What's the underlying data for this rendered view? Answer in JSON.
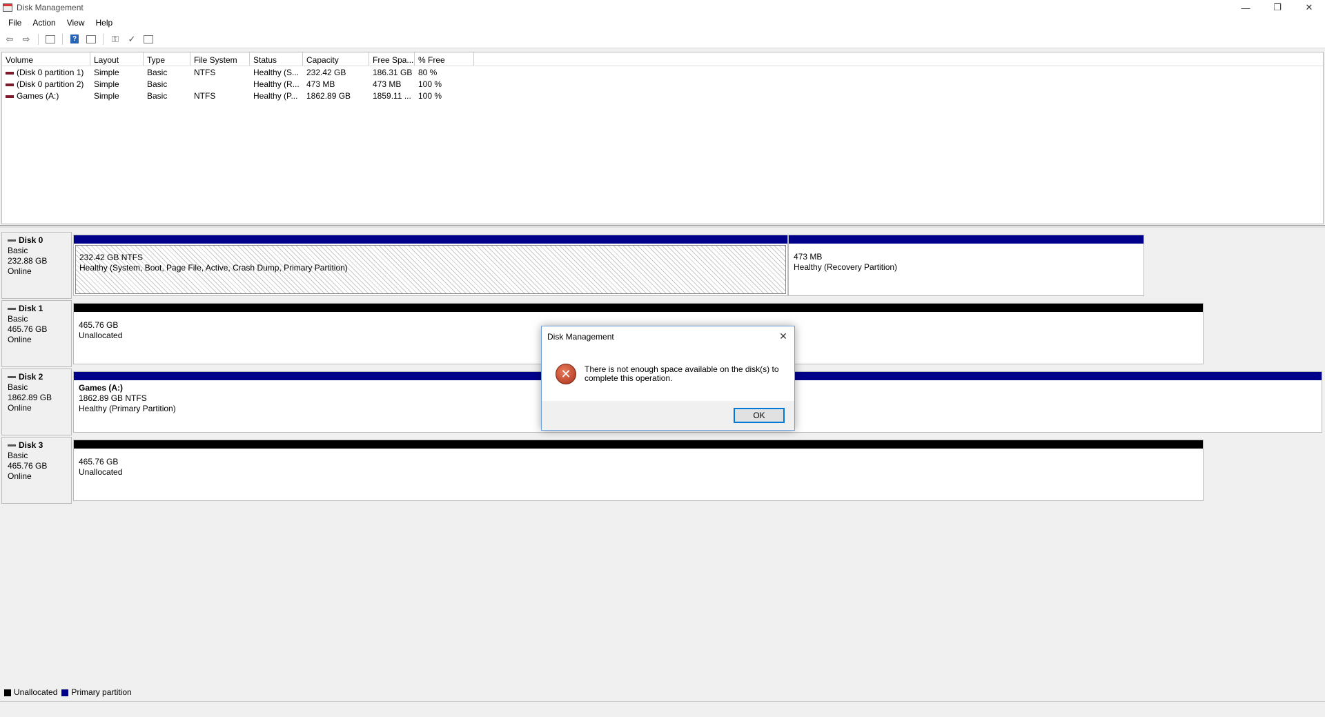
{
  "window": {
    "title": "Disk Management",
    "minimize_glyph": "—",
    "restore_glyph": "❐",
    "close_glyph": "✕"
  },
  "menu": [
    "File",
    "Action",
    "View",
    "Help"
  ],
  "toolbar": {
    "back_glyph": "⇦",
    "forward_glyph": "⇨",
    "help_glyph": "?",
    "check_glyph": "✓",
    "key_glyph": "⚿"
  },
  "volume_table": {
    "headers": [
      "Volume",
      "Layout",
      "Type",
      "File System",
      "Status",
      "Capacity",
      "Free Spa...",
      "% Free"
    ],
    "rows": [
      [
        "(Disk 0 partition 1)",
        "Simple",
        "Basic",
        "NTFS",
        "Healthy (S...",
        "232.42 GB",
        "186.31 GB",
        "80 %"
      ],
      [
        "(Disk 0 partition 2)",
        "Simple",
        "Basic",
        "",
        "Healthy (R...",
        "473 MB",
        "473 MB",
        "100 %"
      ],
      [
        "Games (A:)",
        "Simple",
        "Basic",
        "NTFS",
        "Healthy (P...",
        "1862.89 GB",
        "1859.11 ...",
        "100 %"
      ]
    ]
  },
  "disks": [
    {
      "name": "Disk 0",
      "type": "Basic",
      "size": "232.88 GB",
      "state": "Online",
      "partitions": [
        {
          "title": "",
          "line1": "232.42 GB NTFS",
          "line2": "Healthy (System, Boot, Page File, Active, Crash Dump, Primary Partition)"
        },
        {
          "title": "",
          "line1": "473 MB",
          "line2": "Healthy (Recovery Partition)"
        }
      ]
    },
    {
      "name": "Disk 1",
      "type": "Basic",
      "size": "465.76 GB",
      "state": "Online",
      "partitions": [
        {
          "title": "",
          "line1": "465.76 GB",
          "line2": "Unallocated"
        }
      ]
    },
    {
      "name": "Disk 2",
      "type": "Basic",
      "size": "1862.89 GB",
      "state": "Online",
      "partitions": [
        {
          "title": "Games  (A:)",
          "line1": "1862.89 GB NTFS",
          "line2": "Healthy (Primary Partition)"
        }
      ]
    },
    {
      "name": "Disk 3",
      "type": "Basic",
      "size": "465.76 GB",
      "state": "Online",
      "partitions": [
        {
          "title": "",
          "line1": "465.76 GB",
          "line2": "Unallocated"
        }
      ]
    }
  ],
  "legend": {
    "unallocated": "Unallocated",
    "primary": "Primary partition"
  },
  "colors": {
    "primary": "#00008b",
    "unallocated": "#000000"
  },
  "dialog": {
    "title": "Disk Management",
    "message": "There is not enough space available on the disk(s) to complete this operation.",
    "ok_label": "OK",
    "close_glyph": "✕",
    "error_glyph": "✕"
  }
}
